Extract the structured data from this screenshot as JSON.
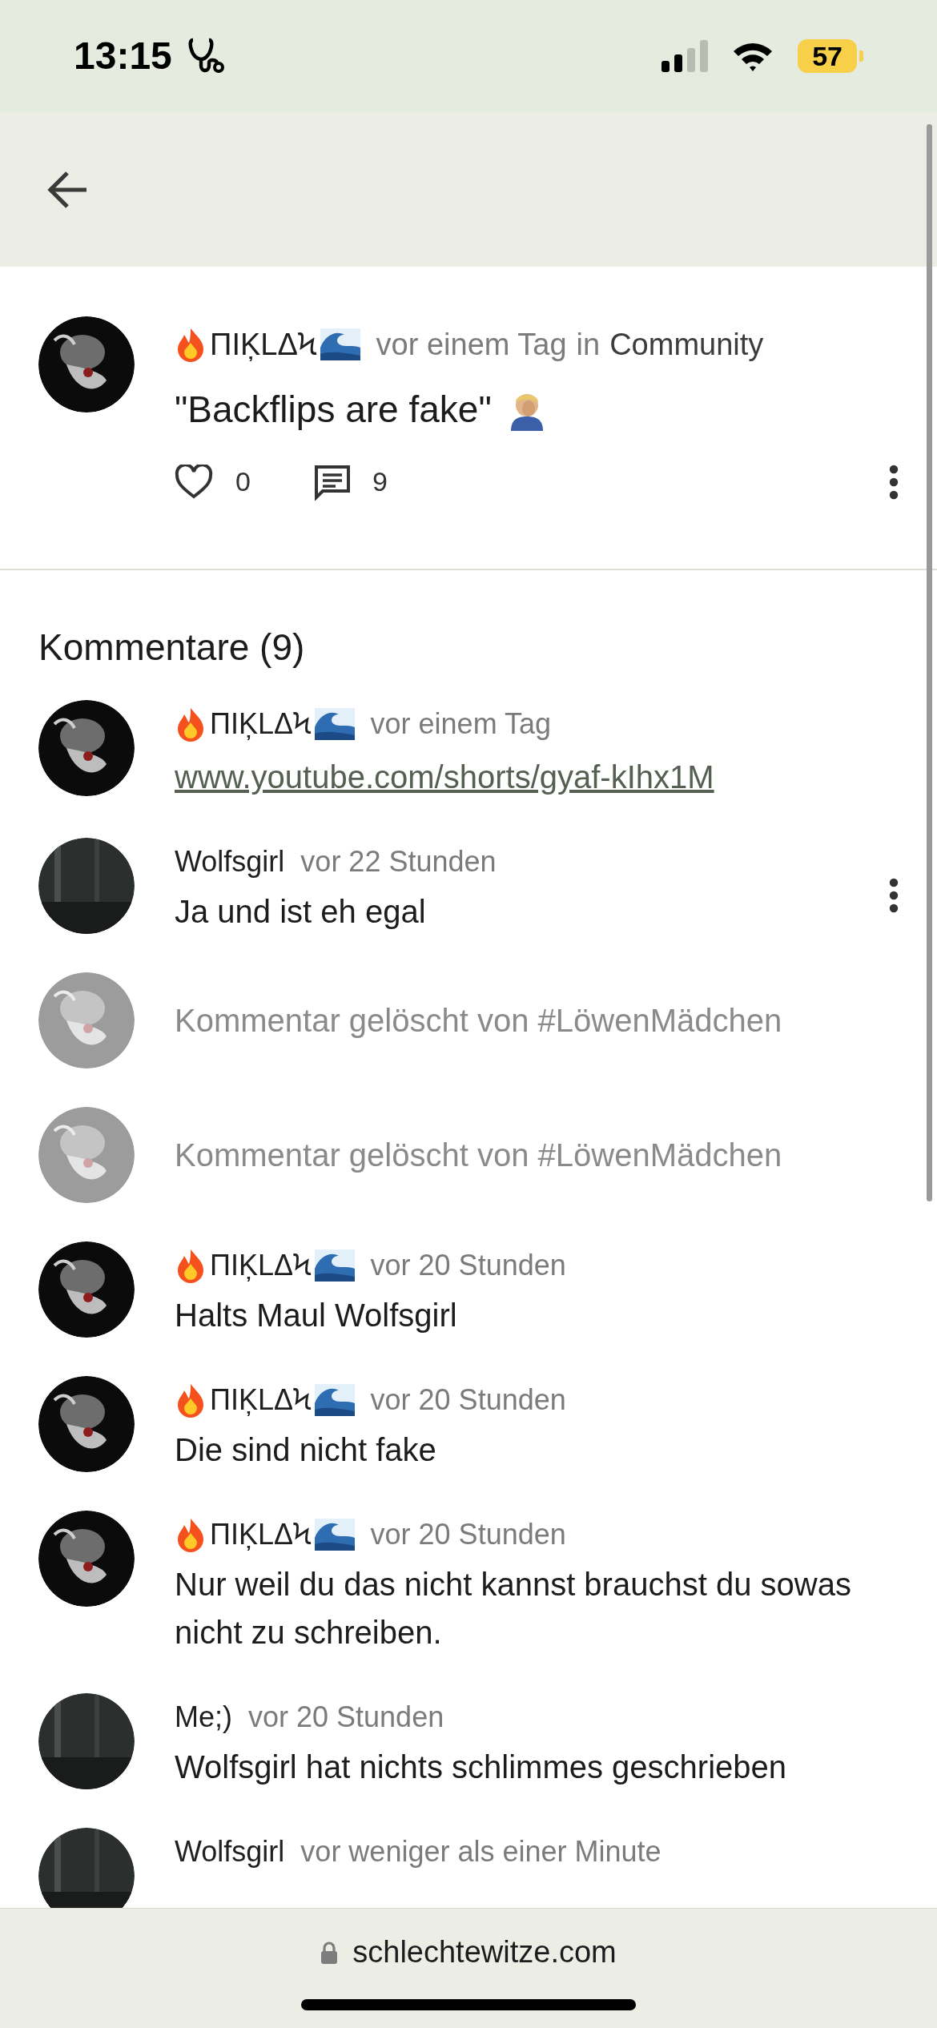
{
  "status_bar": {
    "time": "13:15",
    "battery": "57"
  },
  "post": {
    "author": "ΠΙĶLΔϞ",
    "time": "vor einem Tag",
    "in": "in",
    "community": "Community",
    "title": "\"Backflips are fake\"",
    "likes": "0",
    "comments": "9"
  },
  "comments_heading": "Kommentare (9)",
  "comments": [
    {
      "kind": "link",
      "author": "ΠΙĶLΔϞ",
      "flair": true,
      "time": "vor einem Tag",
      "text": "www.youtube.com/shorts/gyaf-kIhx1M",
      "menu": false
    },
    {
      "kind": "text",
      "author": "Wolfsgirl",
      "flair": false,
      "time": "vor 22 Stunden",
      "text": "Ja und ist eh egal",
      "menu": true
    },
    {
      "kind": "deleted",
      "text": "Kommentar gelöscht von #LöwenMädchen",
      "menu": false
    },
    {
      "kind": "deleted",
      "text": "Kommentar gelöscht von #LöwenMädchen",
      "menu": false
    },
    {
      "kind": "text",
      "author": "ΠΙĶLΔϞ",
      "flair": true,
      "time": "vor 20 Stunden",
      "text": "Halts Maul Wolfsgirl",
      "menu": false
    },
    {
      "kind": "text",
      "author": "ΠΙĶLΔϞ",
      "flair": true,
      "time": "vor 20 Stunden",
      "text": "Die sind nicht fake",
      "menu": false
    },
    {
      "kind": "text",
      "author": "ΠΙĶLΔϞ",
      "flair": true,
      "time": "vor 20 Stunden",
      "text": "Nur weil du das nicht kannst brauchst du sowas nicht zu schreiben.",
      "menu": false
    },
    {
      "kind": "text",
      "author": "Me;)",
      "flair": false,
      "time": "vor 20 Stunden",
      "text": "Wolfsgirl hat nichts schlimmes geschrieben",
      "menu": false
    },
    {
      "kind": "header",
      "author": "Wolfsgirl",
      "flair": false,
      "time": "vor weniger als einer Minute",
      "menu": false
    }
  ],
  "address_bar": {
    "domain": "schlechtewitze.com"
  }
}
